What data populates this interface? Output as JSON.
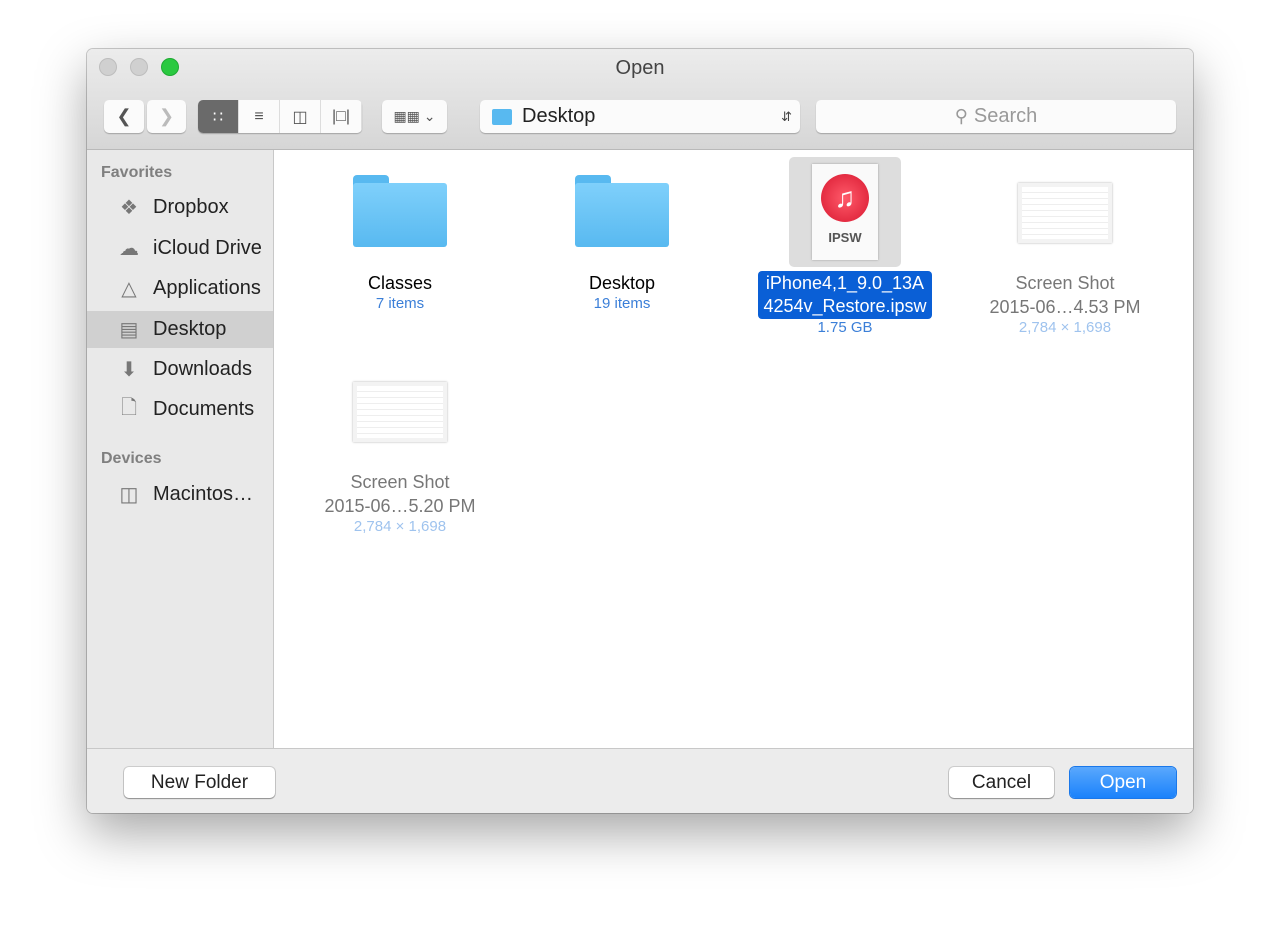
{
  "window": {
    "title": "Open"
  },
  "toolbar": {
    "location": "Desktop",
    "search_placeholder": "Search"
  },
  "sidebar": {
    "favorites_header": "Favorites",
    "favorites": [
      {
        "label": "Dropbox",
        "icon": "dropbox-icon"
      },
      {
        "label": "iCloud Drive",
        "icon": "cloud-icon"
      },
      {
        "label": "Applications",
        "icon": "applications-icon"
      },
      {
        "label": "Desktop",
        "icon": "desktop-icon",
        "selected": true
      },
      {
        "label": "Downloads",
        "icon": "downloads-icon"
      },
      {
        "label": "Documents",
        "icon": "documents-icon"
      }
    ],
    "devices_header": "Devices",
    "devices": [
      {
        "label": "Macintos…",
        "icon": "harddisk-icon"
      }
    ]
  },
  "files": [
    {
      "name": "Classes",
      "sub": "7 items"
    },
    {
      "name": "Desktop",
      "sub": "19 items"
    },
    {
      "name1": "iPhone4,1_9.0_13A",
      "name2": "4254v_Restore.ipsw",
      "sub": "1.75 GB",
      "badge": "IPSW",
      "selected": true
    },
    {
      "name1": "Screen Shot",
      "name2": "2015-06…4.53 PM",
      "sub": "2,784 × 1,698"
    },
    {
      "name1": "Screen Shot",
      "name2": "2015-06…5.20 PM",
      "sub": "2,784 × 1,698"
    }
  ],
  "buttons": {
    "new_folder": "New Folder",
    "cancel": "Cancel",
    "open": "Open"
  },
  "colors": {
    "accent": "#1a82fb",
    "selection": "#0a5fd6"
  }
}
